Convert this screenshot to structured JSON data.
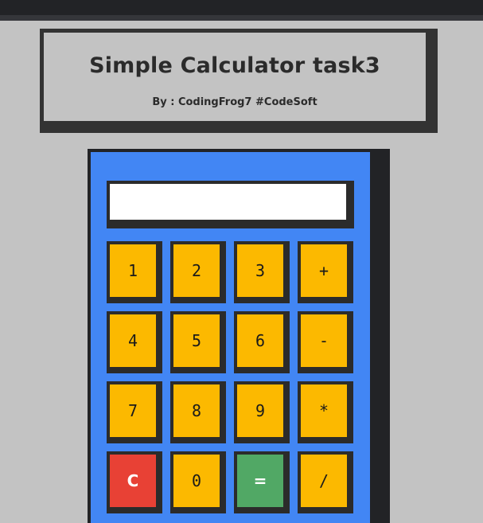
{
  "header": {
    "title": "Simple Calculator task3",
    "subtitle": "By : CodingFrog7 #CodeSoft"
  },
  "display": {
    "value": ""
  },
  "keys": [
    {
      "label": "1",
      "name": "key-1"
    },
    {
      "label": "2",
      "name": "key-2"
    },
    {
      "label": "3",
      "name": "key-3"
    },
    {
      "label": "+",
      "name": "key-plus"
    },
    {
      "label": "4",
      "name": "key-4"
    },
    {
      "label": "5",
      "name": "key-5"
    },
    {
      "label": "6",
      "name": "key-6"
    },
    {
      "label": "-",
      "name": "key-minus"
    },
    {
      "label": "7",
      "name": "key-7"
    },
    {
      "label": "8",
      "name": "key-8"
    },
    {
      "label": "9",
      "name": "key-9"
    },
    {
      "label": "*",
      "name": "key-multiply"
    },
    {
      "label": "C",
      "name": "key-clear"
    },
    {
      "label": "0",
      "name": "key-0"
    },
    {
      "label": "=",
      "name": "key-equals"
    },
    {
      "label": "/",
      "name": "key-divide"
    }
  ],
  "colors": {
    "background": "#c3c3c3",
    "calculator_body": "#4286f4",
    "key_default": "#fcb900",
    "key_clear": "#e84135",
    "key_equals": "#51a865",
    "frame": "#2b2b2b"
  }
}
